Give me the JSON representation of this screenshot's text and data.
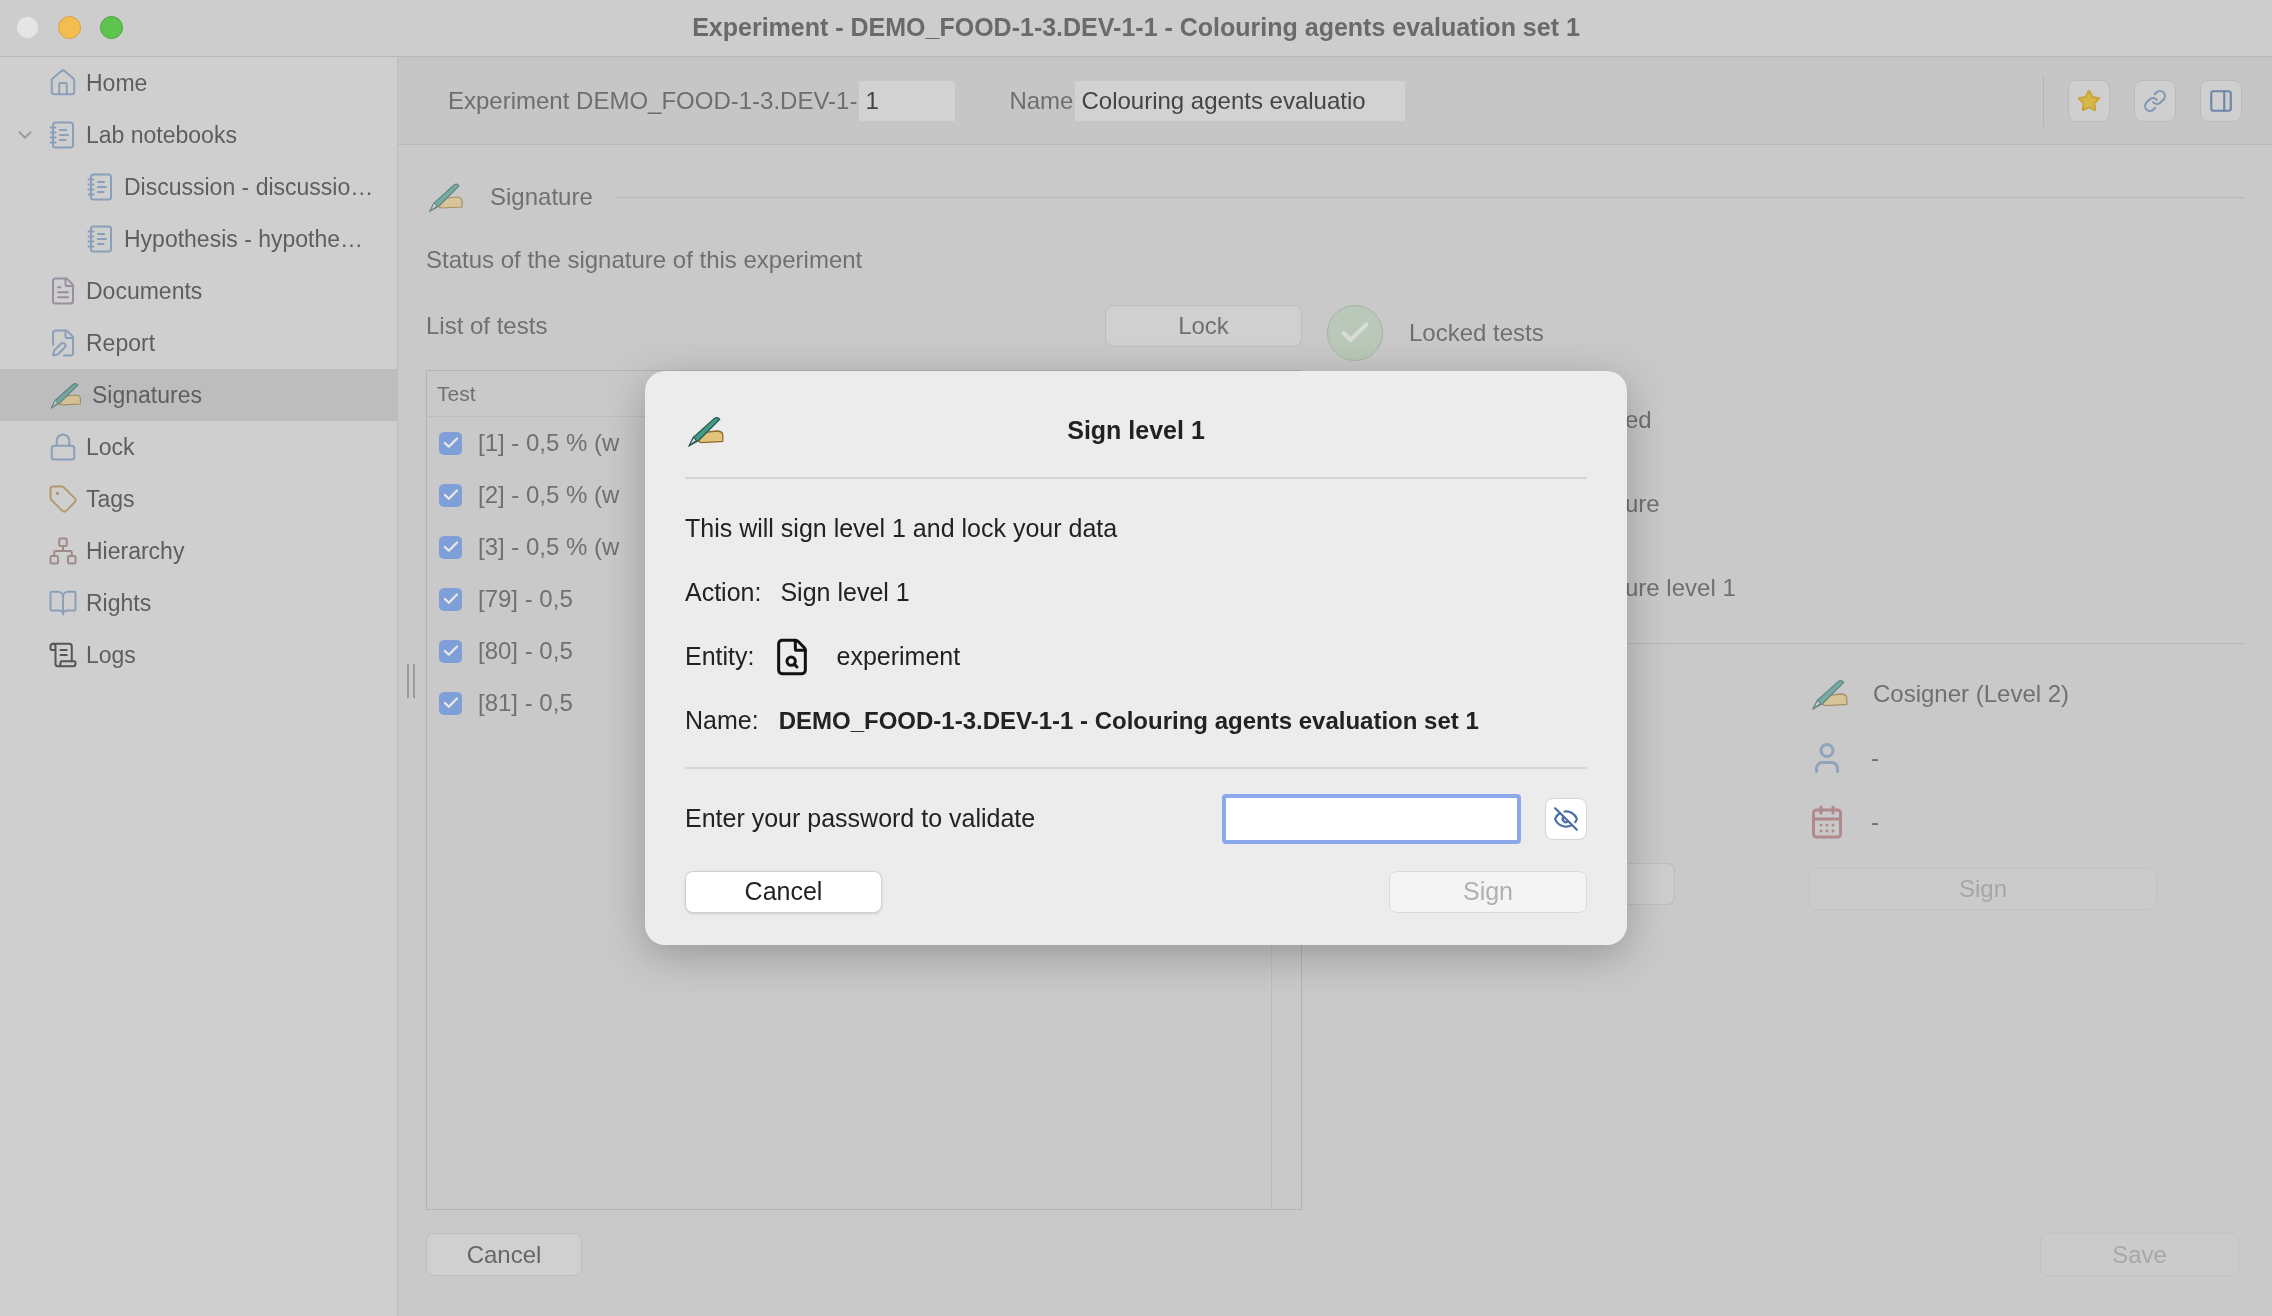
{
  "window": {
    "title": "Experiment - DEMO_FOOD-1-3.DEV-1-1 - Colouring agents evaluation set 1"
  },
  "sidebar": {
    "items": [
      {
        "label": "Home",
        "selected": false
      },
      {
        "label": "Lab notebooks",
        "selected": false,
        "expanded": true,
        "children": [
          {
            "label": "Discussion - discussio…",
            "selected": false
          },
          {
            "label": "Hypothesis - hypothe…",
            "selected": false
          }
        ]
      },
      {
        "label": "Documents",
        "selected": false
      },
      {
        "label": "Report",
        "selected": false
      },
      {
        "label": "Signatures",
        "selected": true
      },
      {
        "label": "Lock",
        "selected": false
      },
      {
        "label": "Tags",
        "selected": false
      },
      {
        "label": "Hierarchy",
        "selected": false
      },
      {
        "label": "Rights",
        "selected": false
      },
      {
        "label": "Logs",
        "selected": false
      }
    ]
  },
  "toolbar": {
    "experiment_label": "Experiment DEMO_FOOD-1-3.DEV-1-",
    "experiment_number": "1",
    "name_label": "Name",
    "name_value": "Colouring agents evaluatio"
  },
  "section": {
    "title": "Signature",
    "status_text": "Status of the signature of this experiment"
  },
  "tests": {
    "label": "List of tests",
    "lock_button": "Lock",
    "column": "Test",
    "rows": [
      {
        "label": "[1] - 0,5 % (w",
        "checked": true
      },
      {
        "label": "[2] - 0,5 % (w",
        "checked": true
      },
      {
        "label": "[3] - 0,5 % (w",
        "checked": true
      },
      {
        "label": "[79] - 0,5",
        "checked": true
      },
      {
        "label": "[80] - 0,5",
        "checked": true
      },
      {
        "label": "[81] - 0,5",
        "checked": true
      }
    ]
  },
  "status": {
    "locked_tests": "Locked tests",
    "locked": true,
    "rows": [
      "ed",
      "ure",
      "ure level 1"
    ]
  },
  "cosigner": {
    "title": "Cosigner (Level 2)",
    "user": "-",
    "date": "-",
    "sign_button": "Sign",
    "sign_disabled": true
  },
  "footer": {
    "cancel": "Cancel",
    "save": "Save",
    "save_disabled": true
  },
  "dialog": {
    "title": "Sign level 1",
    "message": "This will sign level 1 and lock your data",
    "fields": [
      {
        "kind": "plain",
        "label": "Action:",
        "value": "Sign level 1"
      },
      {
        "kind": "entity",
        "label": "Entity:",
        "value": "experiment"
      },
      {
        "kind": "name",
        "label": "Name:",
        "value": "DEMO_FOOD-1-3.DEV-1-1 - Colouring agents evaluation set 1"
      }
    ],
    "password_label": "Enter your password to validate",
    "cancel": "Cancel",
    "sign": "Sign",
    "sign_disabled": true
  }
}
